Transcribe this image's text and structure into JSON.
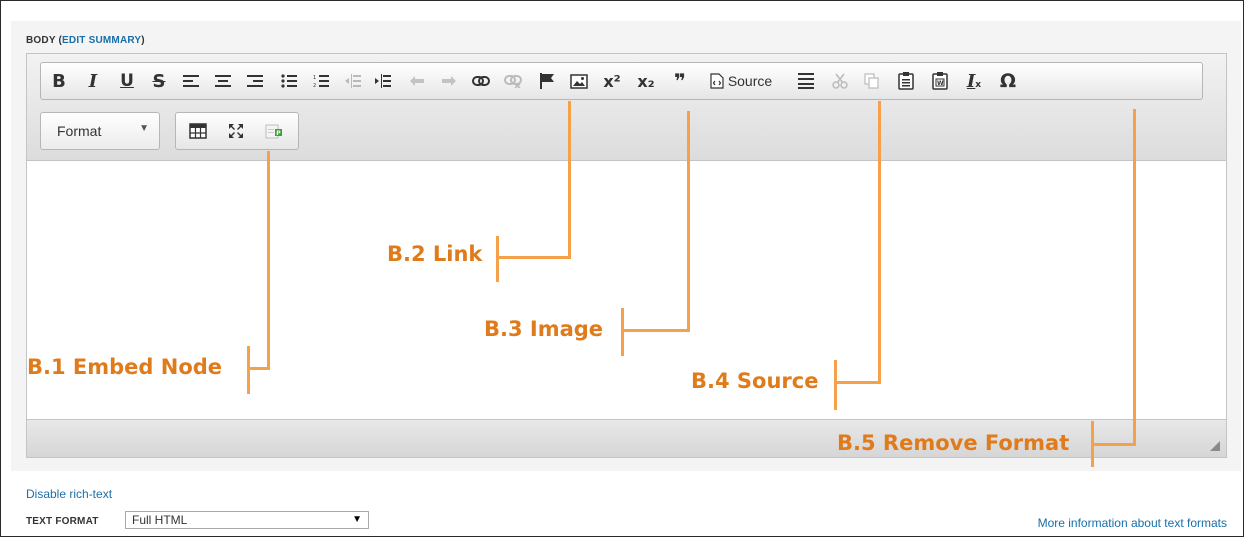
{
  "field": {
    "label": "BODY",
    "open_paren": " (",
    "edit_summary": "EDIT SUMMARY",
    "close_paren": ")"
  },
  "toolbar": {
    "row1": [
      {
        "name": "bold-button",
        "glyph": "B",
        "icon": "bold-icon"
      },
      {
        "name": "italic-button",
        "glyph": "I",
        "icon": "italic-icon"
      },
      {
        "name": "underline-button",
        "glyph": "U",
        "icon": "underline-icon"
      },
      {
        "name": "strikethrough-button",
        "glyph": "S",
        "icon": "strikethrough-icon"
      },
      {
        "name": "align-left-button",
        "glyph": "",
        "icon": "align-left-icon"
      },
      {
        "name": "align-center-button",
        "glyph": "",
        "icon": "align-center-icon"
      },
      {
        "name": "align-right-button",
        "glyph": "",
        "icon": "align-right-icon"
      },
      {
        "name": "bulleted-list-button",
        "glyph": "",
        "icon": "bulleted-list-icon"
      },
      {
        "name": "numbered-list-button",
        "glyph": "",
        "icon": "numbered-list-icon"
      },
      {
        "name": "outdent-button",
        "glyph": "",
        "icon": "outdent-icon",
        "disabled": true
      },
      {
        "name": "indent-button",
        "glyph": "",
        "icon": "indent-icon"
      },
      {
        "name": "undo-button",
        "glyph": "",
        "icon": "undo-icon",
        "disabled": true
      },
      {
        "name": "redo-button",
        "glyph": "",
        "icon": "redo-icon",
        "disabled": true
      },
      {
        "name": "link-button",
        "glyph": "",
        "icon": "link-icon"
      },
      {
        "name": "unlink-button",
        "glyph": "",
        "icon": "unlink-icon",
        "disabled": true
      },
      {
        "name": "anchor-button",
        "glyph": "",
        "icon": "flag-icon"
      },
      {
        "name": "image-button",
        "glyph": "",
        "icon": "image-icon"
      },
      {
        "name": "superscript-button",
        "glyph": "x²",
        "icon": "superscript-icon"
      },
      {
        "name": "subscript-button",
        "glyph": "x₂",
        "icon": "subscript-icon"
      },
      {
        "name": "blockquote-button",
        "glyph": "❞",
        "icon": "quote-icon"
      },
      {
        "name": "source-button",
        "glyph": "",
        "icon": "source-icon",
        "label": "Source"
      },
      {
        "name": "horizontal-rule-button",
        "glyph": "",
        "icon": "horizontal-rule-icon"
      },
      {
        "name": "cut-button",
        "glyph": "",
        "icon": "scissors-icon",
        "disabled": true
      },
      {
        "name": "copy-button",
        "glyph": "",
        "icon": "copy-icon",
        "disabled": true
      },
      {
        "name": "paste-text-button",
        "glyph": "",
        "icon": "paste-text-icon"
      },
      {
        "name": "paste-word-button",
        "glyph": "",
        "icon": "paste-word-icon"
      },
      {
        "name": "remove-format-button",
        "glyph": "I",
        "icon": "remove-format-icon"
      },
      {
        "name": "special-character-button",
        "glyph": "Ω",
        "icon": "omega-icon"
      }
    ],
    "format_label": "Format",
    "row2": [
      {
        "name": "table-button",
        "icon": "table-icon"
      },
      {
        "name": "maximize-button",
        "icon": "maximize-icon"
      },
      {
        "name": "embed-node-button",
        "icon": "embed-node-icon"
      }
    ]
  },
  "annotations": {
    "b1": "B.1 Embed Node",
    "b2": "B.2 Link",
    "b3": "B.3 Image",
    "b4": "B.4 Source",
    "b5": "B.5 Remove Format"
  },
  "colors": {
    "annotation": "#e07b1b",
    "annotation_line": "#f5a04a",
    "link": "#1a6fa8"
  },
  "footer": {
    "disable_rich_text": "Disable rich-text",
    "text_format_label": "TEXT FORMAT",
    "text_format_value": "Full HTML",
    "more_info": "More information about text formats"
  }
}
